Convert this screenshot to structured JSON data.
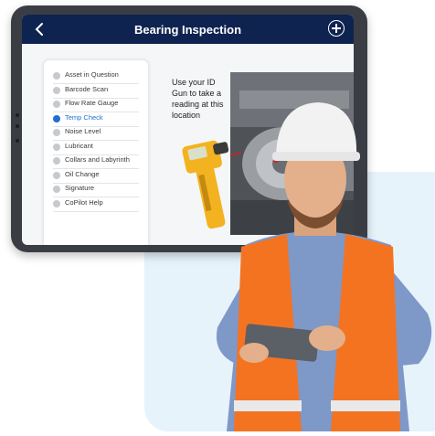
{
  "app": {
    "title": "Bearing Inspection",
    "back_icon": "chevron-left-icon",
    "add_icon": "plus-circle-icon"
  },
  "steps": [
    {
      "label": "Asset in Question",
      "active": false
    },
    {
      "label": "Barcode Scan",
      "active": false
    },
    {
      "label": "Flow Rate Gauge",
      "active": false
    },
    {
      "label": "Temp Check",
      "active": true
    },
    {
      "label": "Noise Level",
      "active": false
    },
    {
      "label": "Lubricant",
      "active": false
    },
    {
      "label": "Collars and Labyrinth",
      "active": false
    },
    {
      "label": "Oil Change",
      "active": false
    },
    {
      "label": "Signature",
      "active": false
    },
    {
      "label": "CoPilot Help",
      "active": false
    }
  ],
  "instruction": "Use your ID Gun to take a reading at this location",
  "colors": {
    "header": "#0f2350",
    "active": "#1f6fd0",
    "inactive": "#c6c9cd",
    "vest": "#f47321",
    "helmet": "#f2f2f2",
    "shirt": "#7e98c8",
    "background_panel": "#e7f3fb"
  }
}
